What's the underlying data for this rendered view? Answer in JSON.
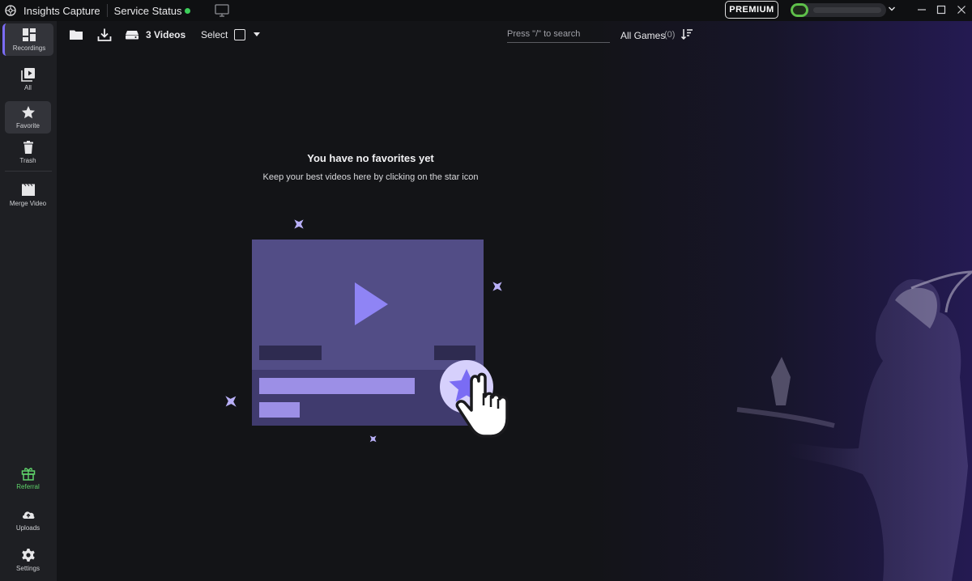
{
  "titlebar": {
    "app_title": "Insights Capture",
    "service_status": "Service Status",
    "premium": "PREMIUM"
  },
  "sidebar": {
    "items": [
      {
        "label": "Recordings",
        "icon": "dashboard-icon"
      },
      {
        "label": "All",
        "icon": "play-library-icon"
      },
      {
        "label": "Favorite",
        "icon": "star-icon"
      },
      {
        "label": "Trash",
        "icon": "trash-icon"
      },
      {
        "label": "Merge Video",
        "icon": "clapperboard-icon"
      }
    ],
    "bottom": [
      {
        "label": "Referral",
        "icon": "gift-icon"
      },
      {
        "label": "Uploads",
        "icon": "cloud-upload-icon"
      },
      {
        "label": "Settings",
        "icon": "gear-icon"
      }
    ]
  },
  "toolbar": {
    "videos_count": "3 Videos",
    "select_label": "Select",
    "search_placeholder": "Press \"/\" to search",
    "games_label": "All Games",
    "games_count": "(0)"
  },
  "empty_state": {
    "title": "You have no favorites yet",
    "subtitle": "Keep your best videos here by clicking on the star icon"
  },
  "colors": {
    "accent": "#7b6cf6",
    "status_online": "#3ccf5a",
    "referral": "#5fd36a",
    "illustration_card": "#524d86",
    "illustration_bar": "#9c8fe6"
  }
}
